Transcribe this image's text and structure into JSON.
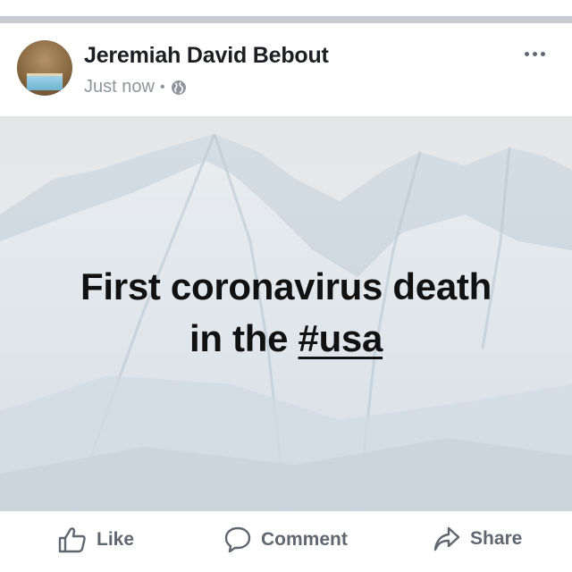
{
  "post": {
    "author": "Jeremiah David Bebout",
    "timestamp": "Just now",
    "separator": "•",
    "privacy_icon": "globe-icon",
    "menu_icon": "more-options-icon",
    "text_line1": "First coronavirus death",
    "text_line2_prefix": "in the ",
    "hashtag": "#usa",
    "background": "snowy-mountain-range"
  },
  "actions": {
    "like_label": "Like",
    "comment_label": "Comment",
    "share_label": "Share"
  },
  "colors": {
    "name": "#1c1e21",
    "meta": "#90949c",
    "action": "#606770",
    "divider": "#c9ccd1",
    "post_text": "#111111"
  }
}
